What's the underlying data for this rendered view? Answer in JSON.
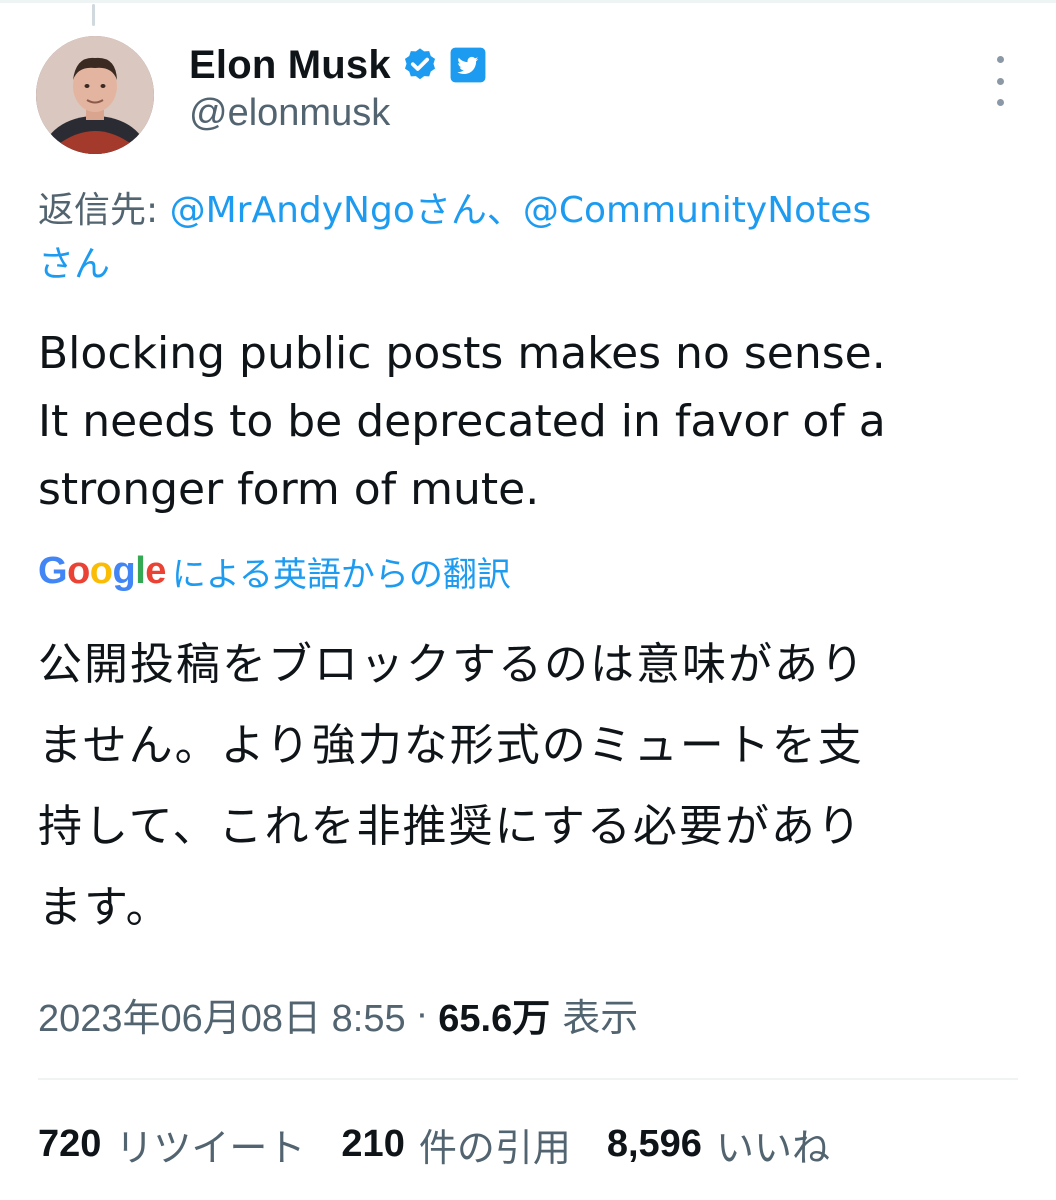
{
  "author": {
    "display_name": "Elon Musk",
    "handle": "@elonmusk",
    "verified": true
  },
  "reply": {
    "prefix": "返信先: ",
    "mention1": "@MrAndyNgoさん",
    "separator": "、",
    "mention2": "@CommunityNotes",
    "suffix": "さん"
  },
  "tweet": {
    "lines": [
      "Blocking public posts makes no sense.",
      "It needs to be deprecated in favor of a",
      "stronger form of mute."
    ]
  },
  "translation": {
    "provider": "Google",
    "label": "による英語からの翻訳",
    "lines": [
      "公開投稿をブロックするのは意味があり",
      "ません。より強力な形式のミュートを支",
      "持して、これを非推奨にする必要があり",
      "ます。"
    ]
  },
  "meta": {
    "timestamp": "2023年06月08日 8:55",
    "separator": "·",
    "views_count": "65.6万",
    "views_label": "表示"
  },
  "stats": {
    "retweets_count": "720",
    "retweets_label": "リツイート",
    "quotes_count": "210",
    "quotes_label": "件の引用",
    "likes_count": "8,596",
    "likes_label": "いいね"
  },
  "colors": {
    "link": "#1d9bf0",
    "secondary": "#536471",
    "primary": "#0f1419"
  }
}
